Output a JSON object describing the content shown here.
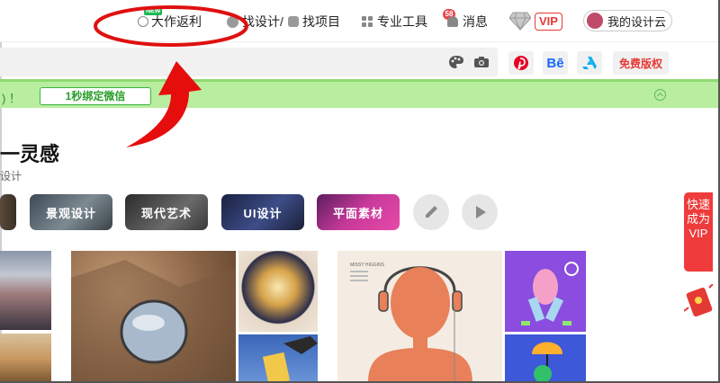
{
  "nav": {
    "new_badge": "NEW",
    "rebate": "大作返利",
    "find_design": "找设计/",
    "find_project": "找项目",
    "tools": "专业工具",
    "messages": "消息",
    "message_count": "58",
    "vip": "VIP",
    "my_cloud": "我的设计云"
  },
  "toolbar": {
    "behance": "Bē",
    "free_copyright": "免费版权"
  },
  "banner": {
    "text": ") ！",
    "bind_button": "1秒绑定微信"
  },
  "heading": {
    "title": "一灵感",
    "subtitle": "设计"
  },
  "categories": [
    "景观设计",
    "现代艺术",
    "UI设计",
    "平面素材"
  ],
  "side": {
    "tab_text": "快速成为VIP"
  },
  "poster": {
    "heading": "MISSY HIGGINS"
  },
  "colors": {
    "accent_green": "#b9eda0",
    "accent_red": "#e53935",
    "annotation_red": "#e01010"
  }
}
